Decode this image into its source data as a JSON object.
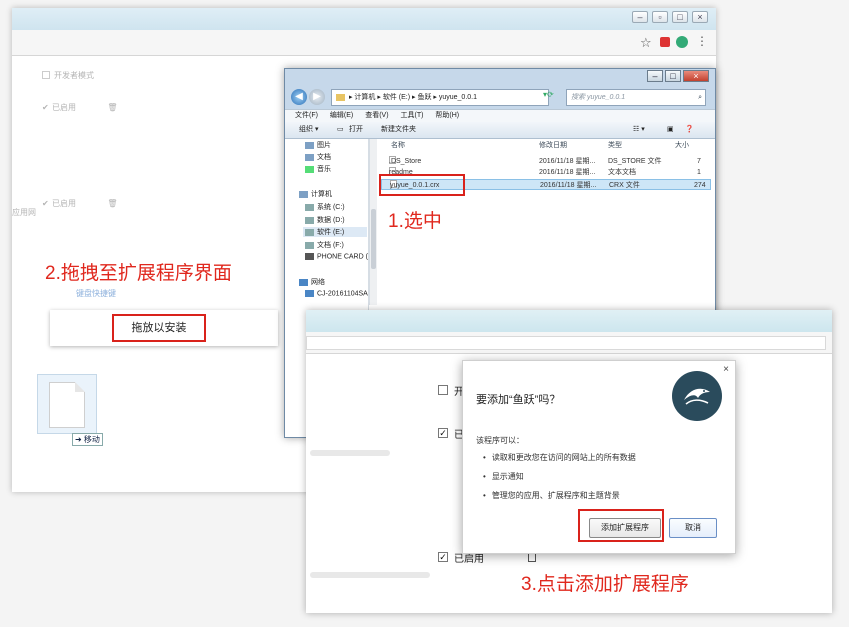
{
  "bg_browser": {
    "dev_mode_label": "开发者模式",
    "enabled_label_1": "已启用",
    "enabled_label_2": "已启用",
    "side_text": "应用网",
    "shortcut_link": "键盘快捷键",
    "drop_button": "拖放以安装",
    "move_tag": "➜ 移动"
  },
  "annotations": {
    "step1": "1.选中",
    "step2": "2.拖拽至扩展程序界面",
    "step3": "3.点击添加扩展程序"
  },
  "explorer": {
    "path": [
      "计算机",
      "软件 (E:)",
      "鱼跃",
      "yuyue_0.0.1"
    ],
    "search_placeholder": "搜索 yuyue_0.0.1",
    "menu": [
      "文件(F)",
      "编辑(E)",
      "查看(V)",
      "工具(T)",
      "帮助(H)"
    ],
    "toolbar": {
      "organize": "组织 ▾",
      "open": "打开",
      "new_folder": "新建文件夹"
    },
    "tree": [
      {
        "label": "图片"
      },
      {
        "label": "文档"
      },
      {
        "label": "音乐"
      },
      {
        "label": "计算机"
      },
      {
        "label": "系统 (C:)"
      },
      {
        "label": "数据 (D:)"
      },
      {
        "label": "软件 (E:)"
      },
      {
        "label": "文档 (F:)"
      },
      {
        "label": "PHONE CARD ("
      },
      {
        "label": "网络"
      },
      {
        "label": "CJ-20161104SA"
      }
    ],
    "columns": {
      "name": "名称",
      "date": "修改日期",
      "type": "类型",
      "size": "大小"
    },
    "files": [
      {
        "name": ".DS_Store",
        "date": "2016/11/18 星期...",
        "type": "DS_STORE 文件",
        "size": "7"
      },
      {
        "name": "readme",
        "date": "2016/11/18 星期...",
        "type": "文本文档",
        "size": "1"
      },
      {
        "name": "yuyue_0.0.1.crx",
        "date": "2016/11/18 星期...",
        "type": "CRX 文件",
        "size": "274"
      }
    ]
  },
  "fg_browser": {
    "dev_partial": "开",
    "enabled_partial": "已",
    "enabled_label": "已启用"
  },
  "dialog": {
    "title": "要添加“鱼跃”吗？",
    "can_label": "该程序可以：",
    "permissions": [
      "读取和更改您在访问的网站上的所有数据",
      "显示通知",
      "管理您的应用、扩展程序和主题背景"
    ],
    "add_button": "添加扩展程序",
    "cancel_button": "取消",
    "close": "×"
  },
  "colors": {
    "annotation_red": "#e0281e",
    "highlight_red": "#d9221b",
    "logo_bg": "#2a4b5c"
  },
  "icons": [
    "star-icon",
    "menu-icon",
    "back-icon",
    "forward-icon",
    "search-icon",
    "trash-icon",
    "file-icon",
    "close-icon",
    "fish-logo-icon"
  ]
}
